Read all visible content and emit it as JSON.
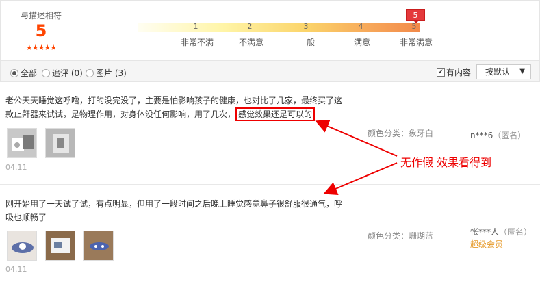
{
  "rating": {
    "label": "与描述相符",
    "score": "5",
    "stars": "★★★★★",
    "flag": "5",
    "ticks": [
      "1",
      "2",
      "3",
      "4",
      "5"
    ],
    "tick_labels": [
      "非常不满",
      "不满意",
      "一般",
      "满意",
      "非常满意"
    ]
  },
  "filters": {
    "all": "全部",
    "followup": "追评 (0)",
    "images": "图片 (3)",
    "has_content": "有内容",
    "sort": "按默认",
    "has_content_checked": true
  },
  "reviews": [
    {
      "text_a": "老公天天睡觉这呼噜，打的没完没了，主要是怕影响孩子的健康，也对比了几家，最终买了这款止鼾器来试试，是物理作用，对身体没任何影响，用了几次，",
      "text_highlight": "感觉效果还是可以的",
      "variant": "颜色分类：象牙白",
      "user": "n***6",
      "anon": "（匿名）",
      "date": "04.11",
      "thumbs": [
        "thumb-photo-1",
        "thumb-photo-2"
      ]
    },
    {
      "text": "刚开始用了一天试了试，有点明显，但用了一段时间之后晚上睡觉感觉鼻子很舒服很通气，呼吸也顺畅了",
      "variant": "颜色分类：珊瑚蓝",
      "user": "怅***人",
      "anon": "（匿名）",
      "badge": "超级会员",
      "date": "04.11",
      "thumbs": [
        "thumb-photo-3",
        "thumb-photo-4",
        "thumb-photo-5"
      ]
    }
  ],
  "annotation": "无作假  效果看得到"
}
